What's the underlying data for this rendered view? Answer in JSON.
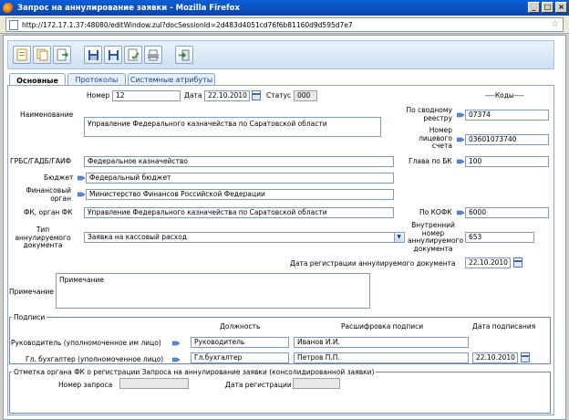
{
  "window": {
    "title": "Запрос на аннулирование заявки - Mozilla Firefox",
    "min": "_",
    "max": "□",
    "close": "×"
  },
  "address": {
    "url": "http://172.17.1.37:48080/editWindow.zul?docSessionId=2d483d4051cd76f6b81160d9d595d7e7"
  },
  "tabs": [
    "Основные",
    "Протоколы",
    "Системные атрибуты"
  ],
  "header": {
    "nomer_label": "Номер",
    "nomer_value": "12",
    "data_label": "Дата",
    "data_value": "22.10.2010",
    "status_label": "Статус",
    "status_value": "000",
    "kody_label": "----Коды----"
  },
  "form": {
    "naimenovanie_label": "Наименование",
    "naimenovanie_value": "Управление Федерального казначейства по Саратовской области",
    "svodny_reestr_label": "По сводному реестру",
    "svodny_reestr_value": "07374",
    "licevoy_label": "Номер лицевого счета",
    "licevoy_value": "03601073740",
    "grbs_label": "ГРБС/ГАДБ/ГАИФ",
    "grbs_value": "Федеральное казначейство",
    "glava_label": "Глава по БК",
    "glava_value": "100",
    "budget_label": "Бюджет",
    "budget_value": "Федеральный бюджет",
    "fin_organ_label": "Финансовый орган",
    "fin_organ_value": "Министерство Финансов Российской Федерации",
    "fk_label": "ФК, орган ФК",
    "fk_value": "Управление Федерального казначейства по Саратовской области",
    "kofk_label": "По КОФК",
    "kofk_value": "6000",
    "tip_label": "Тип аннулируемого документа",
    "tip_value": "Заявка на кассовый расход",
    "vnutr_label": "Внутренний номер аннулируемого документа",
    "vnutr_value": "653",
    "data_reg_label": "Дата регистрации аннулируемого документа",
    "data_reg_value": "22.10.2010",
    "primechanie_label": "Примечание",
    "primechanie_value": "Примечание"
  },
  "signatures": {
    "legend": "Подписи",
    "col_position": "Должность",
    "col_decode": "Расшифровка подписи",
    "col_date": "Дата подписания",
    "rows": [
      {
        "label": "Руководитель (уполномоченное им лицо)",
        "position": "Руководитель",
        "name": "Иванов И.И.",
        "date": ""
      },
      {
        "label": "Гл. бухгалтер (уполномоченное лицо)",
        "position": "Гл.бухгалтер",
        "name": "Петров П.П.",
        "date": "22.10.2010"
      }
    ]
  },
  "registration": {
    "legend": "Отметка органа ФК о регистрации Запроса на аннулирование заявки (консолидированной заявки)",
    "nomer_label": "Номер запроса",
    "nomer_value": "",
    "data_label": "Дата регистрации",
    "data_value": ""
  },
  "colors": {
    "accent": "#15428b",
    "border": "#7f9db9",
    "toolbar": "#cfe0f3"
  },
  "toolbar_icons": [
    "new-doc-icon",
    "copy-doc-icon",
    "export-icon",
    "save-icon",
    "save-close-icon",
    "check-doc-icon",
    "print-icon",
    "exit-icon"
  ]
}
